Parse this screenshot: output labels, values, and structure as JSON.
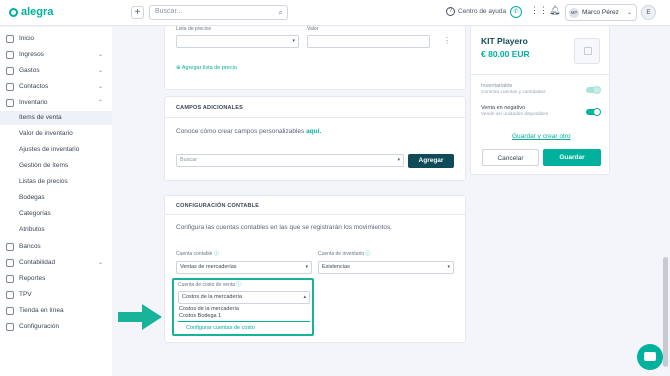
{
  "topbar": {
    "brand": "alegra",
    "add_label": "+",
    "search_placeholder": "Buscar...",
    "help_label": "Centro de ayuda",
    "user_initials": "MP",
    "user_name": "Marco Pérez",
    "org_initial": "E"
  },
  "sidebar": {
    "items": [
      {
        "label": "Inicio",
        "icon": "home-icon"
      },
      {
        "label": "Ingresos",
        "icon": "income-icon",
        "chevron": "expand"
      },
      {
        "label": "Gastos",
        "icon": "expense-icon",
        "chevron": "expand"
      },
      {
        "label": "Contactos",
        "icon": "contacts-icon",
        "chevron": "expand"
      },
      {
        "label": "Inventario",
        "icon": "inventory-icon",
        "chevron": "collapse"
      }
    ],
    "inventory_sub": [
      "Items de venta",
      "Valor de inventario",
      "Ajustes de inventario",
      "Gestión de ítems",
      "Listas de precios",
      "Bodegas",
      "Categorías",
      "Atributos"
    ],
    "bottom_items": [
      {
        "label": "Bancos",
        "icon": "bank-icon"
      },
      {
        "label": "Contabilidad",
        "icon": "accounting-icon",
        "chevron": "expand"
      },
      {
        "label": "Reportes",
        "icon": "reports-icon"
      },
      {
        "label": "TPV",
        "icon": "pos-icon"
      },
      {
        "label": "Tienda en línea",
        "icon": "store-icon"
      },
      {
        "label": "Configuración",
        "icon": "settings-icon"
      }
    ]
  },
  "prices": {
    "list_label": "Lista de precios",
    "value_label": "Valor",
    "add_list_link": "Agregar lista de precio"
  },
  "additional": {
    "title": "CAMPOS ADICIONALES",
    "text": "Conoce cómo crear campos personalizables",
    "text_link": "aquí.",
    "search_placeholder": "Buscar",
    "add_button": "Agregar"
  },
  "accounting": {
    "title": "CONFIGURACIÓN CONTABLE",
    "description": "Configura las cuentas contables en las que se registrarán los movimientos.",
    "account_label": "Cuenta contable",
    "account_value": "Ventas de mercaderías",
    "inventory_label": "Cuenta de inventario",
    "inventory_value": "Existencias",
    "cost_label": "Cuenta de costo de venta",
    "cost_value": "Costos de la mercadería",
    "options": [
      "Costos de la mercadería",
      "Costos Bodega 1"
    ],
    "configure_link": "Configurar cuentas de costo"
  },
  "product": {
    "name": "KIT Playero",
    "price": "€ 80.00 EUR",
    "inventoriable_label": "Inventariable",
    "inventoriable_desc": "Controla cuentas y cantidades",
    "negative_label": "Venta en negativo",
    "negative_desc": "Vende sin unidades disponibles",
    "save_and_create": "Guardar y crear otro",
    "cancel": "Cancelar",
    "save": "Guardar",
    "inventoriable_on": true,
    "negative_on": true
  },
  "colors": {
    "brand": "#00b19d",
    "dark_button": "#0f4a58",
    "highlight": "#17b49a"
  }
}
